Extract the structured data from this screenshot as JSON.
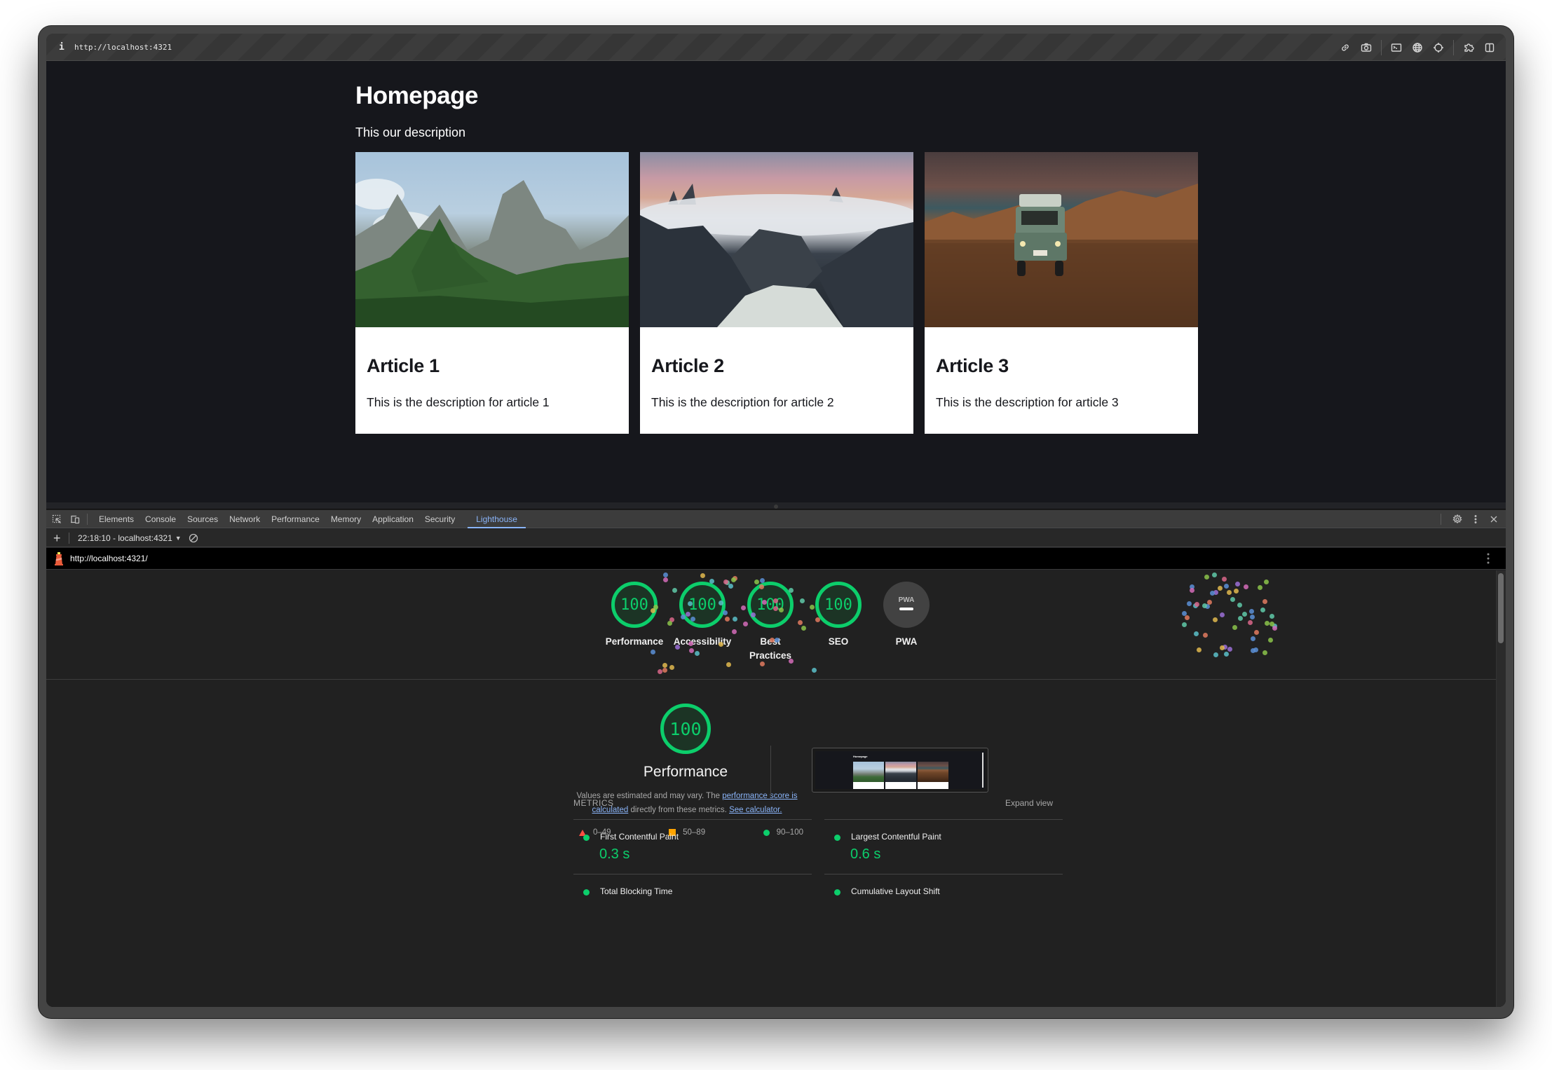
{
  "browser": {
    "url": "http://localhost:4321",
    "tools": [
      "link-icon",
      "camera-icon",
      "terminal-icon",
      "globe-icon",
      "crosshair-icon",
      "extension-icon",
      "split-panel-icon"
    ]
  },
  "page": {
    "title": "Homepage",
    "description": "This our description",
    "articles": [
      {
        "title": "Article 1",
        "description": "This is the description for article 1",
        "image": "mountain-landscape"
      },
      {
        "title": "Article 2",
        "description": "This is the description for article 2",
        "image": "fjord-clouds"
      },
      {
        "title": "Article 3",
        "description": "This is the description for article 3",
        "image": "land-rover-desert"
      }
    ]
  },
  "devtools": {
    "tabs": [
      {
        "label": "Elements"
      },
      {
        "label": "Console"
      },
      {
        "label": "Sources"
      },
      {
        "label": "Network"
      },
      {
        "label": "Performance"
      },
      {
        "label": "Memory"
      },
      {
        "label": "Application"
      },
      {
        "label": "Security"
      },
      {
        "label": "Lighthouse",
        "active": true
      }
    ],
    "toolbar": {
      "add": "+",
      "report_select": "22:18:10 - localhost:4321"
    },
    "report_url": "http://localhost:4321/"
  },
  "lighthouse": {
    "accent": "#0cce6b",
    "scores": [
      {
        "label": "Performance",
        "score": "100"
      },
      {
        "label": "Accessibility",
        "score": "100"
      },
      {
        "label": "Best Practices",
        "score": "100"
      },
      {
        "label": "SEO",
        "score": "100"
      },
      {
        "label": "PWA",
        "score": "PWA"
      }
    ],
    "performance": {
      "score": "100",
      "title": "Performance",
      "note_prefix": "Values are estimated and may vary. The ",
      "note_link1": "performance score is calculated",
      "note_middle": " directly from these metrics. ",
      "note_link2": "See calculator.",
      "legend": [
        {
          "range": "0–49",
          "color": "#ff4e42"
        },
        {
          "range": "50–89",
          "color": "#ffa400"
        },
        {
          "range": "90–100",
          "color": "#0cce6b"
        }
      ],
      "screenshot_title": "Homepage"
    },
    "metrics": {
      "heading": "METRICS",
      "expand": "Expand view",
      "items": [
        {
          "name": "First Contentful Paint",
          "value": "0.3 s"
        },
        {
          "name": "Largest Contentful Paint",
          "value": "0.6 s"
        },
        {
          "name": "Total Blocking Time",
          "value": ""
        },
        {
          "name": "Cumulative Layout Shift",
          "value": ""
        }
      ]
    }
  }
}
